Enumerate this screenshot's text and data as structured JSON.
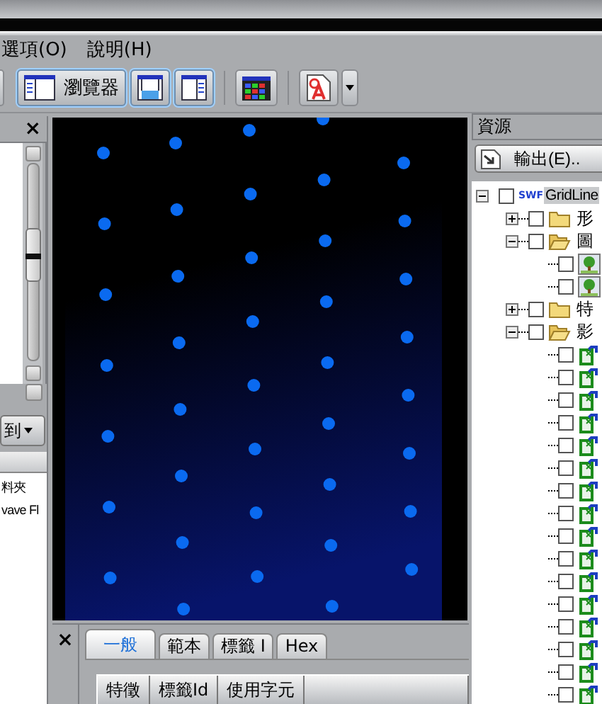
{
  "menu": [
    {
      "label": "選項(O)"
    },
    {
      "label": "說明(H)"
    }
  ],
  "toolbar": {
    "browser_button": "瀏覽器"
  },
  "left_panel": {
    "close": "×",
    "move_button": "到",
    "list_items": [
      "料夾",
      "vave Fl"
    ]
  },
  "bottom_panel": {
    "close": "×",
    "tabs": [
      {
        "label": "一般",
        "selected": true
      },
      {
        "label": "範本",
        "selected": false
      },
      {
        "label": "標籤 I",
        "selected": false
      },
      {
        "label": "Hex",
        "selected": false
      }
    ],
    "columns": [
      "特徵",
      "標籤Id",
      "使用字元",
      ""
    ]
  },
  "resources": {
    "title": "資源",
    "export_button": "輸出(E)..",
    "tree": {
      "label": "GridLine",
      "kind": "swf",
      "icon_text": "SWF",
      "checked": false,
      "expanded": true,
      "children": [
        {
          "label": "形",
          "kind": "folder",
          "checked": false,
          "expanded": false
        },
        {
          "label": "圖",
          "kind": "folder",
          "checked": false,
          "expanded": true,
          "children": [
            {
              "kind": "image",
              "checked": false
            },
            {
              "kind": "image",
              "checked": false
            }
          ]
        },
        {
          "label": "特",
          "kind": "folder",
          "checked": false,
          "expanded": false
        },
        {
          "label": "影",
          "kind": "folder",
          "checked": false,
          "expanded": true,
          "children": [
            {
              "kind": "clip",
              "checked": false
            },
            {
              "kind": "clip",
              "checked": false
            },
            {
              "kind": "clip",
              "checked": false
            },
            {
              "kind": "clip",
              "checked": false
            },
            {
              "kind": "clip",
              "checked": false
            },
            {
              "kind": "clip",
              "checked": false
            },
            {
              "kind": "clip",
              "checked": false
            },
            {
              "kind": "clip",
              "checked": false
            },
            {
              "kind": "clip",
              "checked": false
            },
            {
              "kind": "clip",
              "checked": false
            },
            {
              "kind": "clip",
              "checked": false
            },
            {
              "kind": "clip",
              "checked": false
            },
            {
              "kind": "clip",
              "checked": false
            },
            {
              "kind": "clip",
              "checked": false
            },
            {
              "kind": "clip",
              "checked": false
            },
            {
              "kind": "clip",
              "checked": false
            }
          ]
        }
      ]
    }
  }
}
